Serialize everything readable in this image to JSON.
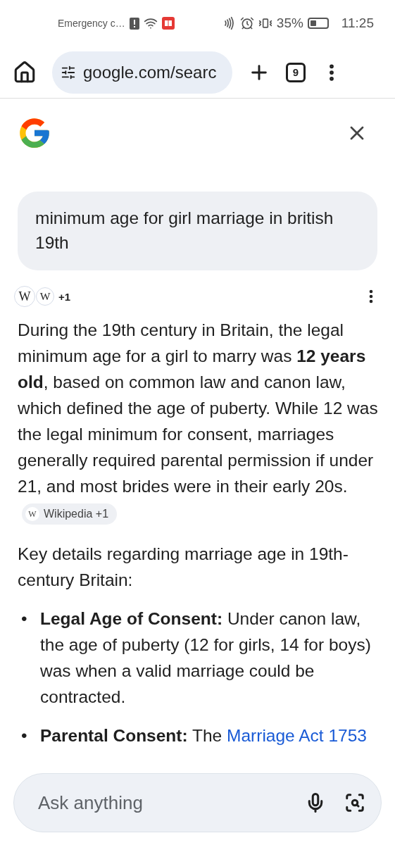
{
  "status_bar": {
    "carrier": "Emergency c…",
    "battery": "35%",
    "time": "11:25"
  },
  "browser": {
    "url": "google.com/searc",
    "tab_count": "9"
  },
  "query": "minimum age for girl marriage in british 19th",
  "sources": {
    "logos": [
      "W",
      "W"
    ],
    "extra": "+1"
  },
  "answer": "During the 19th century in Britain, the legal minimum age for a girl to marry was **12 years old**, based on common law and canon law, which defined the age of puberty. While 12 was the legal minimum for consent, marriages generally required parental permission if under 21, and most brides were in their early 20s.",
  "citation": {
    "logo": "W",
    "label": "Wikipedia +1"
  },
  "heading": "Key details regarding marriage age in 19th-century Britain:",
  "bullets": [
    {
      "marker": "•",
      "term": "Legal Age of Consent:",
      "text": "Under canon law, the age of puberty (12 for girls, 14 for boys) was when a valid marriage could be contracted."
    },
    {
      "marker": "•",
      "term": "Parental Consent:",
      "text": "The",
      "link": "Marriage Act 1753"
    }
  ],
  "ask": {
    "placeholder": "Ask anything"
  }
}
